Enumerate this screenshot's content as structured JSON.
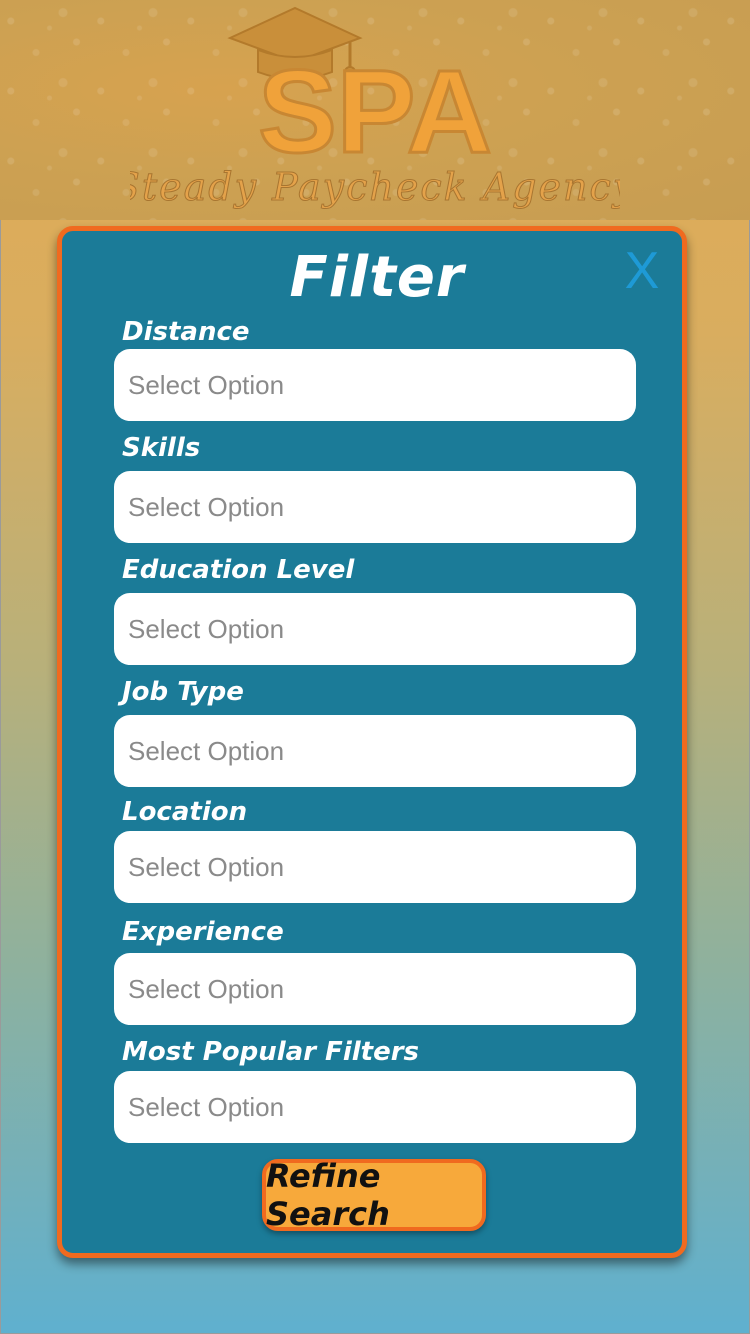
{
  "header": {
    "logo_text": "SPA",
    "tagline": "Steady Paycheck Agency"
  },
  "modal": {
    "title": "Filter",
    "close_label": "X"
  },
  "fields": [
    {
      "label": "Distance",
      "placeholder": "Select Option"
    },
    {
      "label": "Skills",
      "placeholder": "Select Option"
    },
    {
      "label": "Education Level",
      "placeholder": "Select Option"
    },
    {
      "label": "Job Type",
      "placeholder": "Select Option"
    },
    {
      "label": "Location",
      "placeholder": "Select Option"
    },
    {
      "label": "Experience",
      "placeholder": "Select Option"
    },
    {
      "label": "Most Popular Filters",
      "placeholder": "Select Option"
    }
  ],
  "actions": {
    "refine_label": "Refine Search"
  },
  "colors": {
    "modal_bg": "#1b7b98",
    "accent_orange": "#f06a1f",
    "button_fill": "#f7a93b",
    "close_blue": "#1e9ad6"
  },
  "icons": [
    "graduation-cap-icon",
    "close-icon"
  ]
}
